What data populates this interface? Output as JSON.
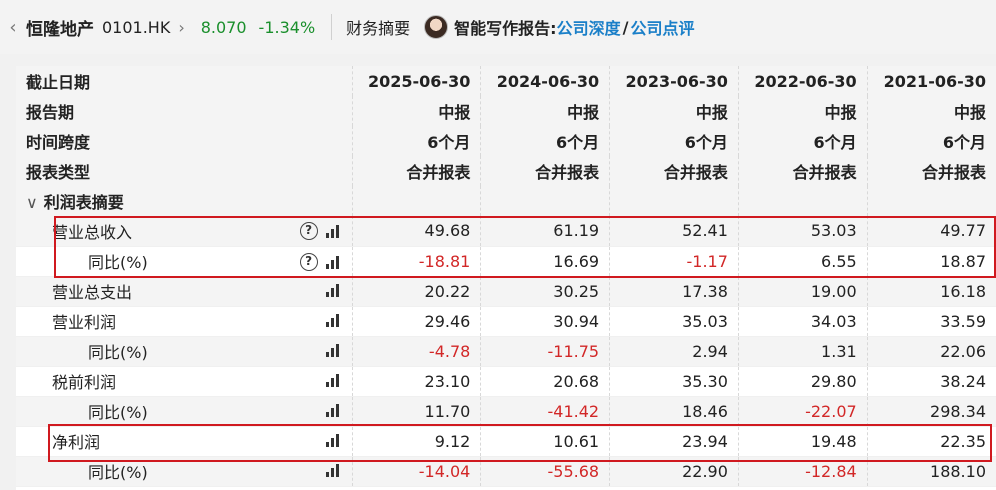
{
  "header": {
    "stock_name": "恒隆地产",
    "stock_code": "0101.HK",
    "price": "8.070",
    "change": "-1.34%",
    "section": "财务摘要",
    "report_label": "智能写作报告:",
    "link_deep": "公司深度",
    "slash": "/",
    "link_review": "公司点评"
  },
  "table": {
    "header_rows": [
      {
        "label": "截止日期",
        "values": [
          "2025-06-30",
          "2024-06-30",
          "2023-06-30",
          "2022-06-30",
          "2021-06-30"
        ]
      },
      {
        "label": "报告期",
        "values": [
          "中报",
          "中报",
          "中报",
          "中报",
          "中报"
        ]
      },
      {
        "label": "时间跨度",
        "values": [
          "6个月",
          "6个月",
          "6个月",
          "6个月",
          "6个月"
        ]
      },
      {
        "label": "报表类型",
        "values": [
          "合并报表",
          "合并报表",
          "合并报表",
          "合并报表",
          "合并报表"
        ]
      }
    ],
    "section_title": "利润表摘要",
    "rows": [
      {
        "label": "营业总收入",
        "values": [
          "49.68",
          "61.19",
          "52.41",
          "53.03",
          "49.77"
        ]
      },
      {
        "label": "同比(%)",
        "values": [
          "-18.81",
          "16.69",
          "-1.17",
          "6.55",
          "18.87"
        ]
      },
      {
        "label": "营业总支出",
        "values": [
          "20.22",
          "30.25",
          "17.38",
          "19.00",
          "16.18"
        ]
      },
      {
        "label": "营业利润",
        "values": [
          "29.46",
          "30.94",
          "35.03",
          "34.03",
          "33.59"
        ]
      },
      {
        "label": "同比(%)",
        "values": [
          "-4.78",
          "-11.75",
          "2.94",
          "1.31",
          "22.06"
        ]
      },
      {
        "label": "税前利润",
        "values": [
          "23.10",
          "20.68",
          "35.30",
          "29.80",
          "38.24"
        ]
      },
      {
        "label": "同比(%)",
        "values": [
          "11.70",
          "-41.42",
          "18.46",
          "-22.07",
          "298.34"
        ]
      },
      {
        "label": "净利润",
        "values": [
          "9.12",
          "10.61",
          "23.94",
          "19.48",
          "22.35"
        ]
      },
      {
        "label": "同比(%)",
        "values": [
          "-14.04",
          "-55.68",
          "22.90",
          "-12.84",
          "188.10"
        ]
      }
    ]
  },
  "colors": {
    "negative": "#d22727",
    "positive_quote": "#1a8f2c",
    "link": "#1a7fc8",
    "highlight": "#d0191f"
  },
  "icons": [
    "back-chevron-icon",
    "chevron-right-icon",
    "help-circle-icon",
    "bar-chart-icon",
    "collapse-caret-icon"
  ]
}
